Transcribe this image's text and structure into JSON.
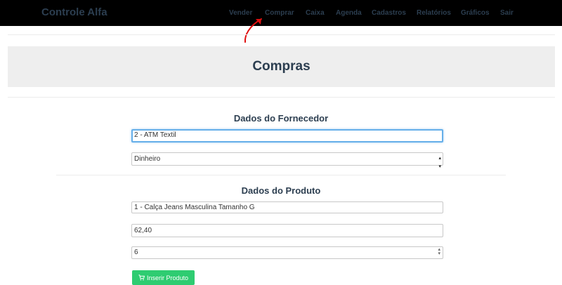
{
  "navbar": {
    "brand": "Controle Alfa",
    "items": [
      {
        "label": "Vender"
      },
      {
        "label": "Comprar"
      },
      {
        "label": "Caixa"
      },
      {
        "label": "Agenda"
      },
      {
        "label": "Cadastros"
      },
      {
        "label": "Relatórios"
      },
      {
        "label": "Gráficos"
      },
      {
        "label": "Sair"
      }
    ]
  },
  "page": {
    "title": "Compras"
  },
  "supplier": {
    "section_title": "Dados do Fornecedor",
    "supplier_value": "2 - ATM Textil",
    "payment_value": "Dinheiro"
  },
  "product": {
    "section_title": "Dados do Produto",
    "product_value": "1 - Calça Jeans Masculina Tamanho G",
    "price_value": "62,40",
    "quantity_value": "6",
    "insert_button": "Inserir Produto"
  },
  "colors": {
    "navbar_bg": "#000000",
    "nav_text": "#2c3e50",
    "accent_green": "#2ecc71",
    "annotation_red": "#e01010"
  },
  "icons": {
    "insert_button_icon": "shopping-cart-icon",
    "annotation": "red-arrow-annotation"
  }
}
